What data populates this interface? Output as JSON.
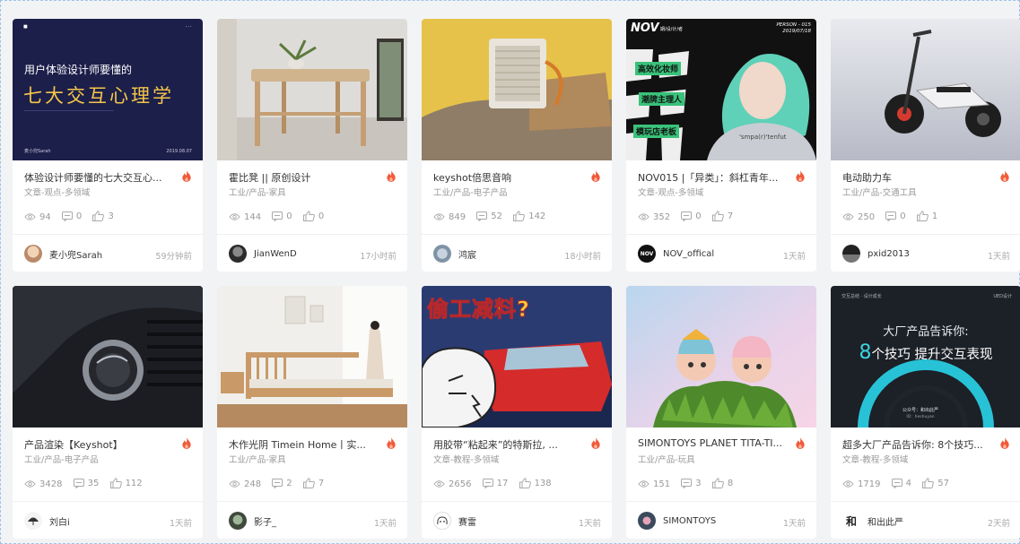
{
  "cards": [
    {
      "cover_small_left": "■",
      "cover_small_right": "⋯",
      "cover_line1": "用户体验设计师要懂的",
      "cover_line2": "七大交互心理学",
      "cover_foot_left": "麦小兜Sarah",
      "cover_foot_right": "2019.08.07",
      "title": "体验设计师要懂的七大交互心...",
      "category": "文章-观点-多领域",
      "views": "94",
      "comments": "0",
      "likes": "3",
      "author": "麦小兜Sarah",
      "time": "59分钟前"
    },
    {
      "title": "霍比凳 || 原创设计",
      "category": "工业/产品-家具",
      "views": "144",
      "comments": "0",
      "likes": "0",
      "author": "JianWenD",
      "time": "17小时前"
    },
    {
      "title": "keyshot倍思音响",
      "category": "工业/产品-电子产品",
      "views": "849",
      "comments": "52",
      "likes": "142",
      "author": "鸿宸",
      "time": "18小时前"
    },
    {
      "cover_big": "NOV",
      "cover_small": "期/设/计/者",
      "cover_person": "PERSON - 015",
      "cover_date": "2019/07/18",
      "cover_tag1": "高效化妆师",
      "cover_tag2": "潮牌主理人",
      "cover_tag3": "模玩店老板",
      "cover_shirt": "'smpa(r)'tenfut",
      "title": "NOV015 |「异类」：斜杠青年...",
      "category": "文章-观点-多领域",
      "views": "352",
      "comments": "0",
      "likes": "7",
      "author": "NOV_offical",
      "avatar_text": "NOV",
      "time": "1天前"
    },
    {
      "title": "电动助力车",
      "category": "工业/产品-交通工具",
      "views": "250",
      "comments": "0",
      "likes": "1",
      "author": "pxid2013",
      "time": "1天前"
    },
    {
      "title": "产品渲染【Keyshot】",
      "category": "工业/产品-电子产品",
      "views": "3428",
      "comments": "35",
      "likes": "112",
      "author": "刘白i",
      "time": "1天前"
    },
    {
      "title": "木作光阴 Timein Home丨实...",
      "category": "工业/产品-家具",
      "views": "248",
      "comments": "2",
      "likes": "7",
      "author": "影子_",
      "time": "1天前"
    },
    {
      "cover_text": "偷工减料?",
      "title": "用胶带“粘起来”的特斯拉, ...",
      "category": "文章-教程-多领域",
      "views": "2656",
      "comments": "17",
      "likes": "138",
      "author": "赛雷",
      "time": "1天前"
    },
    {
      "title": "SIMONTOYS PLANET TITA-TI...",
      "category": "工业/产品-玩具",
      "views": "151",
      "comments": "3",
      "likes": "8",
      "author": "SIMONTOYS",
      "time": "1天前"
    },
    {
      "cover_top_left": "交互总结 · 设计成长",
      "cover_top_right": "UED设计",
      "cover_line1": "大厂产品告诉你:",
      "cover_num": "8",
      "cover_line2": "个技巧 提升交互表现",
      "cover_badge1": "公众号：和出此严",
      "cover_badge2": "ID：heshuyan",
      "title": "超多大厂产品告诉你: 8个技巧...",
      "category": "文章-教程-多领域",
      "views": "1719",
      "comments": "4",
      "likes": "57",
      "author": "和出此严",
      "avatar_text": "和",
      "time": "2天前"
    }
  ],
  "colors": {
    "flame": "#f05a3a",
    "meta": "#999999",
    "text": "#333333",
    "page_bg": "#f2f3f5"
  }
}
